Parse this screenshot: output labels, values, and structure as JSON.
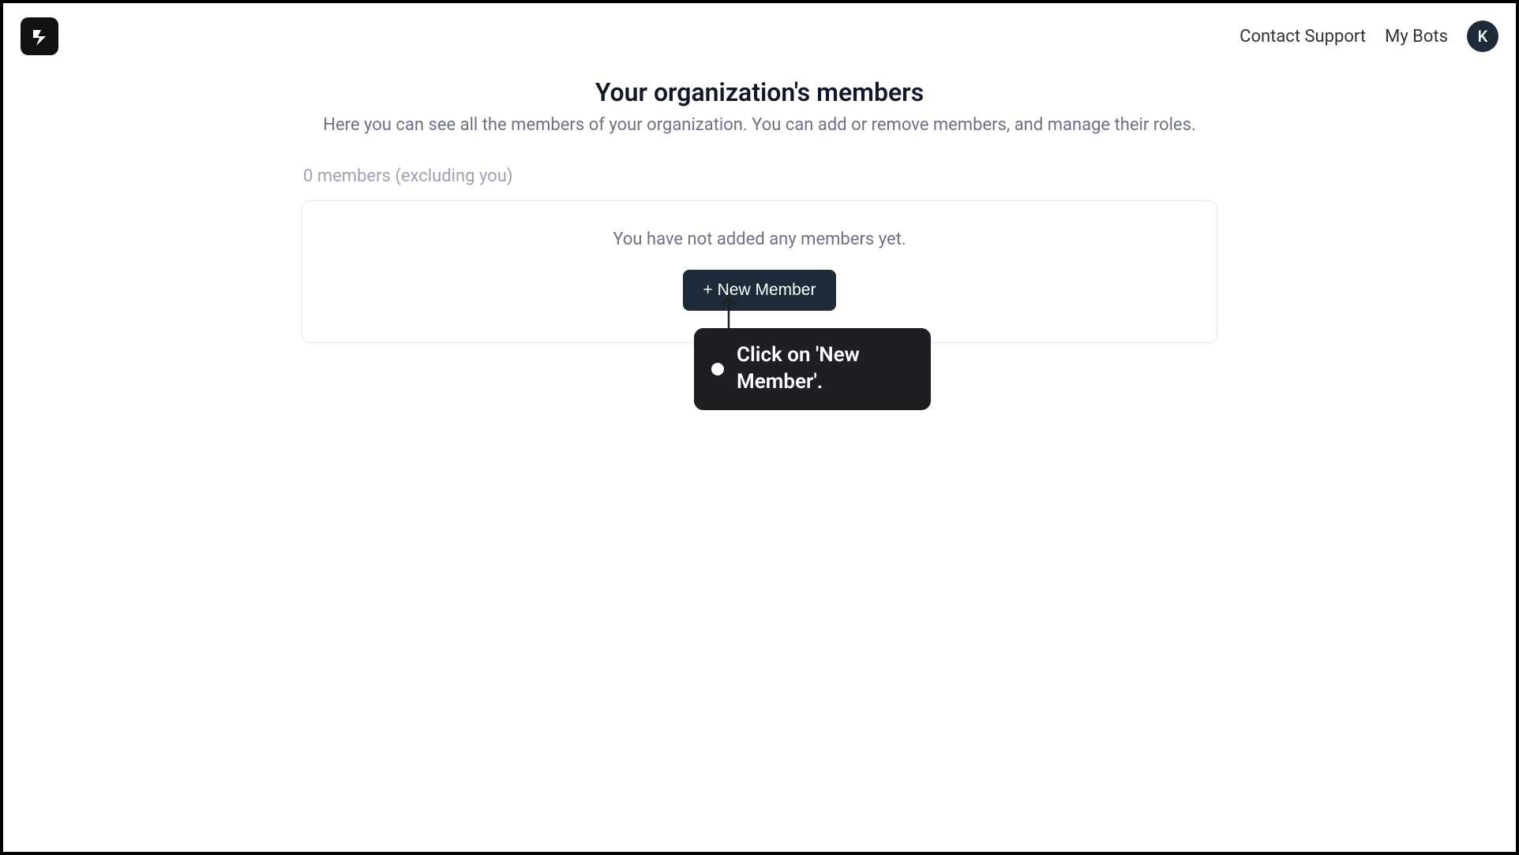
{
  "header": {
    "contact_support": "Contact Support",
    "my_bots": "My Bots",
    "avatar_initial": "K"
  },
  "page": {
    "title": "Your organization's members",
    "subtitle": "Here you can see all the members of your organization. You can add or remove members, and manage their roles.",
    "member_count": "0 members (excluding you)",
    "empty_text": "You have not added any members yet.",
    "new_member_button": "+ New Member"
  },
  "callout": {
    "text": "Click on 'New Member'."
  }
}
